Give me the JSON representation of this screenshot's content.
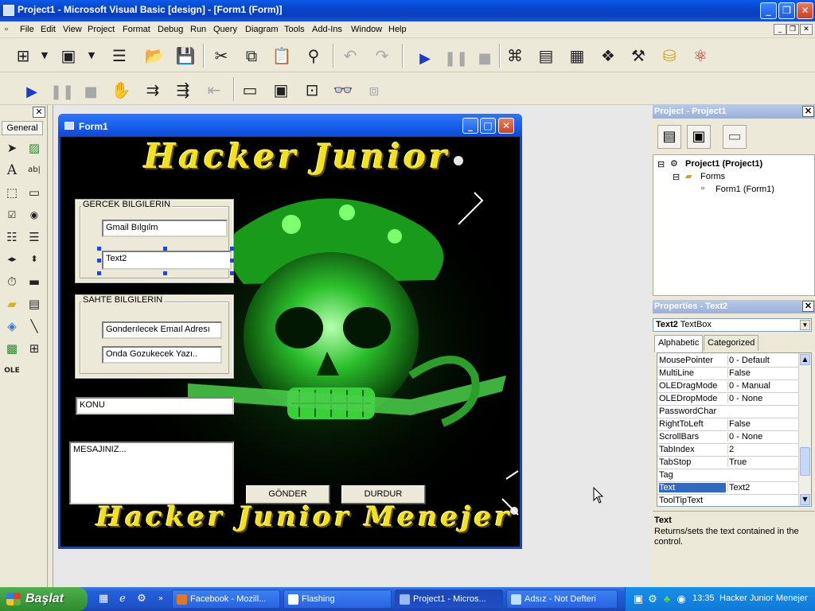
{
  "window": {
    "title": "Project1 - Microsoft Visual Basic [design] - [Form1 (Form)]"
  },
  "menu": [
    "File",
    "Edit",
    "View",
    "Project",
    "Format",
    "Debug",
    "Run",
    "Query",
    "Diagram",
    "Tools",
    "Add-Ins",
    "Window",
    "Help"
  ],
  "toolbox": {
    "tab": "General"
  },
  "form": {
    "title": "Form1",
    "banner_top": "Hacker Junior",
    "banner_bottom": "Hacker Junior Menejer",
    "frame1": {
      "caption": "GERCEK BILGILERIN",
      "field1": "Gmail Bılgılm",
      "field2": "Text2"
    },
    "frame2": {
      "caption": "SAHTE BILGILERIN",
      "field1": "Gonderılecek Emaıl Adresı",
      "field2": "Onda Gozukecek Yazı.."
    },
    "subject": "KONU",
    "message": "MESAJINIZ...",
    "send_button": "GÖNDER",
    "stop_button": "DURDUR"
  },
  "project": {
    "header": "Project - Project1",
    "tree": {
      "root": "Project1 (Project1)",
      "folder": "Forms",
      "item": "Form1 (Form1)"
    }
  },
  "properties": {
    "header": "Properties - Text2",
    "object_name": "Text2",
    "object_type": "TextBox",
    "tab_alphabetic": "Alphabetic",
    "tab_categorized": "Categorized",
    "rows": [
      {
        "name": "MousePointer",
        "value": "0 - Default"
      },
      {
        "name": "MultiLine",
        "value": "False"
      },
      {
        "name": "OLEDragMode",
        "value": "0 - Manual"
      },
      {
        "name": "OLEDropMode",
        "value": "0 - None"
      },
      {
        "name": "PasswordChar",
        "value": ""
      },
      {
        "name": "RightToLeft",
        "value": "False"
      },
      {
        "name": "ScrollBars",
        "value": "0 - None"
      },
      {
        "name": "TabIndex",
        "value": "2"
      },
      {
        "name": "TabStop",
        "value": "True"
      },
      {
        "name": "Tag",
        "value": ""
      },
      {
        "name": "Text",
        "value": "Text2"
      },
      {
        "name": "ToolTipText",
        "value": ""
      }
    ],
    "selected_row": "Text",
    "desc_title": "Text",
    "desc_text": "Returns/sets the text contained in the control."
  },
  "taskbar": {
    "start": "Başlat",
    "tasks": [
      "Facebook - Mozill...",
      "Flashing",
      "Project1 - Micros...",
      "Adsız - Not Defteri"
    ],
    "clock": "13:35",
    "tray_text": "Hacker Junior Menejer"
  }
}
